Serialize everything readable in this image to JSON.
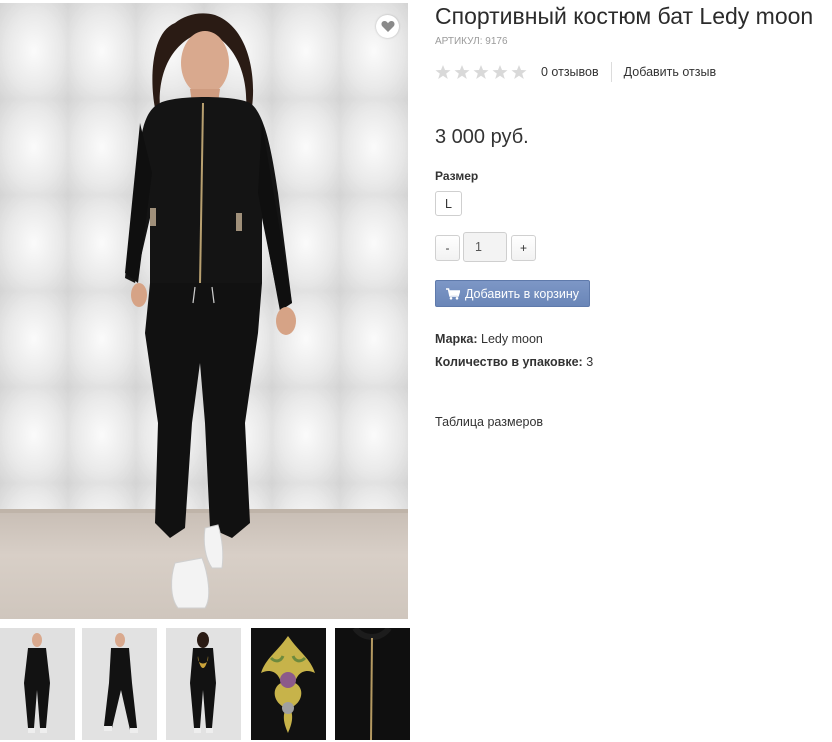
{
  "product": {
    "title": "Спортивный костюм бат Ledy moon",
    "sku_label": "АРТИКУЛ:",
    "sku": "9176",
    "price": "3 000 руб.",
    "rating": 0,
    "rating_max": 5,
    "reviews_link": "0 отзывов",
    "add_review_link": "Добавить отзыв"
  },
  "options": {
    "size_label": "Размер",
    "sizes": [
      "L"
    ]
  },
  "quantity": {
    "minus_label": "-",
    "value": "1",
    "plus_label": "+"
  },
  "cart": {
    "button_label": "Добавить в корзину",
    "icon": "cart-icon"
  },
  "attributes": {
    "brand_label": "Марка:",
    "brand_value": "Ledy moon",
    "pack_label": "Количество в упаковке:",
    "pack_value": "3"
  },
  "links": {
    "size_table": "Таблица размеров"
  },
  "icons": {
    "favorite": "heart-icon",
    "rating": "star-icon"
  },
  "colors": {
    "accent_button": "#7389bd",
    "star_empty": "#d9d9d9",
    "heart": "#8a8a8a"
  },
  "gallery": {
    "thumbnail_count": 5
  }
}
